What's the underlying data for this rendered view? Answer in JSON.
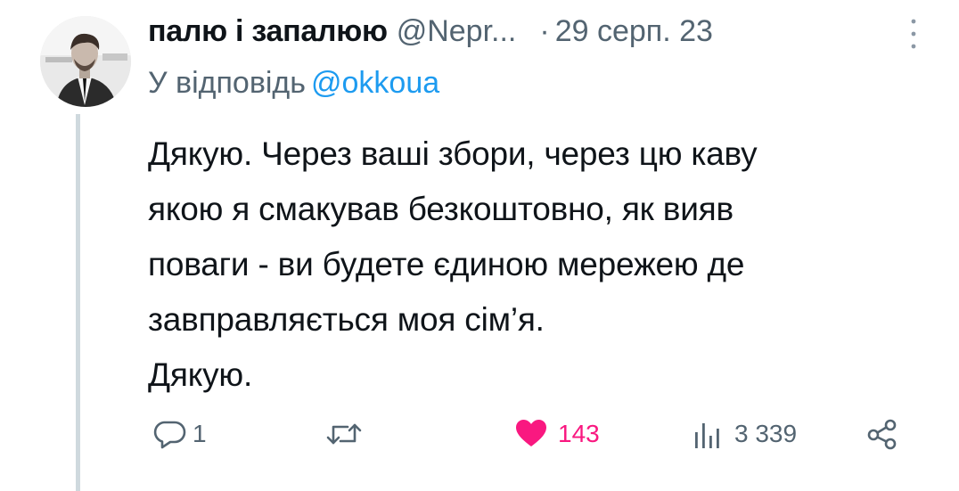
{
  "author": {
    "display_name": "палю і запалюю",
    "handle": "@Nepr...",
    "separator": "·",
    "date": "29 серп. 23"
  },
  "reply_to": {
    "label": "У відповідь",
    "mention": "@okkoua"
  },
  "tweet": {
    "text": "Дякую. Через ваші збори, через цю каву\nякою я смакував безкоштовно, як вияв\nповаги - ви будете єдиною мережею де\nзавправляється моя сім’я.\nДякую."
  },
  "actions": {
    "replies": "1",
    "retweets": "",
    "likes": "143",
    "views": "3 339"
  },
  "icons": {
    "more": "more-vertical-icon",
    "reply": "reply-bubble-icon",
    "retweet": "retweet-icon",
    "like": "heart-filled-icon",
    "views": "views-bar-chart-icon",
    "share": "share-icon"
  },
  "colors": {
    "text": "#0f1419",
    "secondary": "#536471",
    "link": "#1d9bf0",
    "like": "#f91880",
    "thread_line": "#cfd9de"
  }
}
